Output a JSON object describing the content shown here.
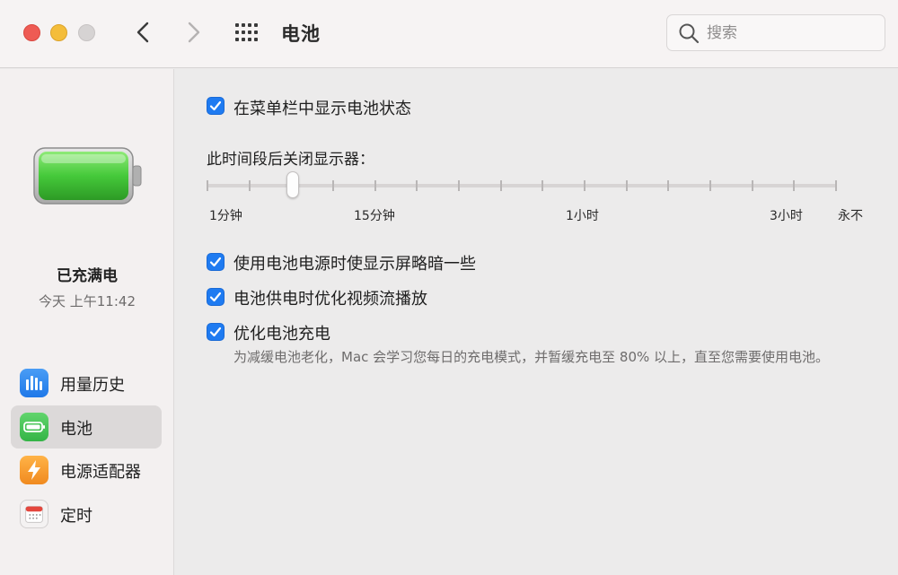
{
  "window": {
    "title": "电池"
  },
  "search": {
    "placeholder": "搜索"
  },
  "sidebar": {
    "battery_status": "已充满电",
    "battery_time": "今天 上午11:42",
    "items": [
      {
        "label": "用量历史",
        "icon": "bar-chart-icon",
        "selected": false
      },
      {
        "label": "电池",
        "icon": "battery-icon",
        "selected": true
      },
      {
        "label": "电源适配器",
        "icon": "lightning-icon",
        "selected": false
      },
      {
        "label": "定时",
        "icon": "calendar-icon",
        "selected": false
      }
    ]
  },
  "main": {
    "show_in_menu_bar": {
      "label": "在菜单栏中显示电池状态",
      "checked": true
    },
    "display_off": {
      "label": "此时间段后关闭显示器：",
      "tick_labels": [
        "1分钟",
        "15分钟",
        "1小时",
        "3小时",
        "永不"
      ],
      "selected_tick_index": 2,
      "tick_count": 16
    },
    "dim_display": {
      "label": "使用电池电源时使显示屏略暗一些",
      "checked": true
    },
    "optimize_video": {
      "label": "电池供电时优化视频流播放",
      "checked": true
    },
    "optimize_charging": {
      "label": "优化电池充电",
      "checked": true,
      "description": "为减缓电池老化，Mac 会学习您每日的充电模式，并暂缓充电至 80% 以上，直至您需要使用电池。"
    }
  },
  "colors": {
    "accent": "#1f7bf1",
    "battery_green": "#4fcf44"
  }
}
